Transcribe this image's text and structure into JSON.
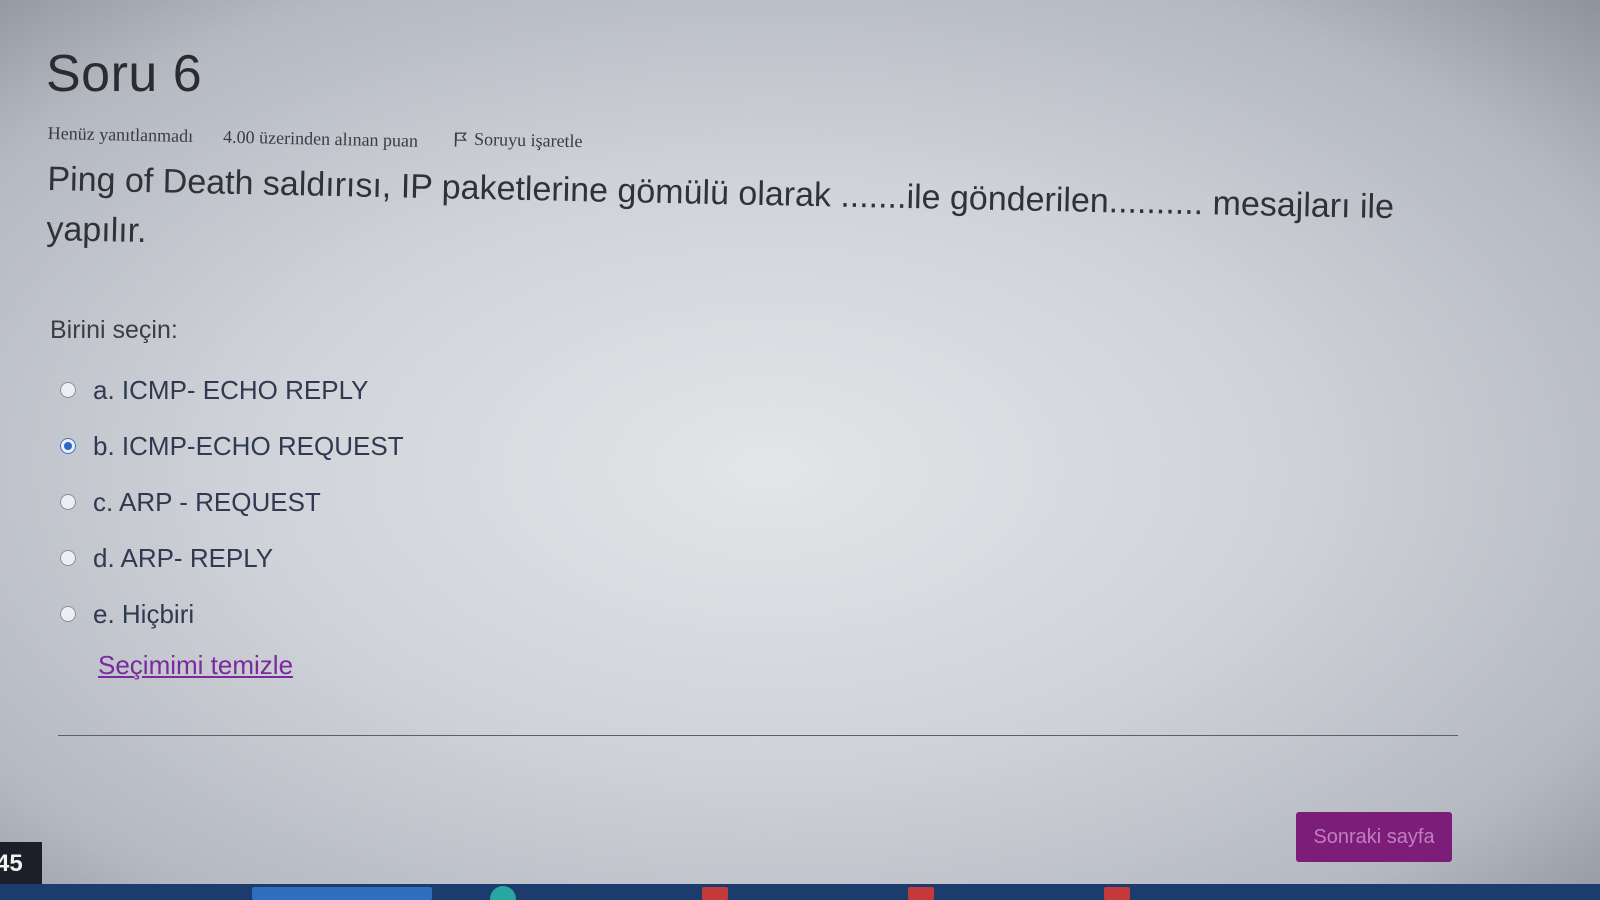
{
  "question": {
    "title": "Soru 6",
    "status": "Henüz yanıtlanmadı",
    "points": "4.00 üzerinden alınan puan",
    "flag_label": "Soruyu işaretle",
    "text": "Ping of Death saldırısı, IP paketlerine gömülü olarak .......ile gönderilen.......... mesajları ile yapılır."
  },
  "answer": {
    "prompt": "Birini seçin:",
    "options": [
      {
        "label": "a. ICMP- ECHO REPLY",
        "selected": false
      },
      {
        "label": "b. ICMP-ECHO REQUEST",
        "selected": true
      },
      {
        "label": "c. ARP - REQUEST",
        "selected": false
      },
      {
        "label": "d. ARP- REPLY",
        "selected": false
      },
      {
        "label": "e. Hiçbiri",
        "selected": false
      }
    ],
    "clear_label": "Seçimimi temizle"
  },
  "navigation": {
    "next_label": "Sonraki sayfa"
  },
  "clock": {
    "text": "45"
  },
  "colors": {
    "accent_purple": "#7b1d79",
    "link_purple": "#7a2a9c",
    "radio_selected": "#2f64cc",
    "taskbar": "#1d3c6e"
  }
}
